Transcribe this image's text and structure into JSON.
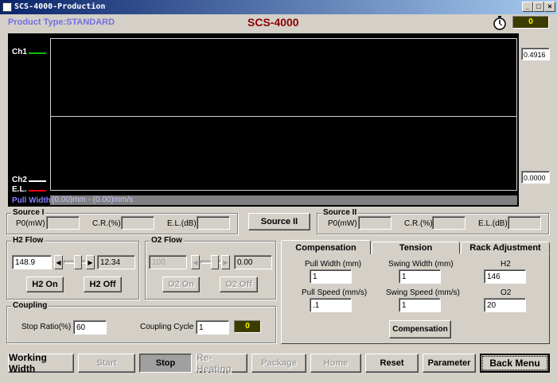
{
  "window": {
    "title": "SCS-4000-Production"
  },
  "header": {
    "product_type": "Product Type:STANDARD",
    "app_title": "SCS-4000",
    "counter": "0"
  },
  "scope": {
    "ch1_label": "Ch1",
    "ch2_label": "Ch2",
    "el_label": "E.L.",
    "pull_width_label": "Pull Width",
    "range_text": "(0.00)mm - (0.00)mm/s",
    "top_value": "0.4916",
    "bottom_value": "0.0000",
    "colors": {
      "ch1": "#00c000",
      "ch2": "#ffffff",
      "el": "#ff0000",
      "pull_width": "#8080ff"
    }
  },
  "source1": {
    "title": "Source I",
    "p0_label": "P0(mW)",
    "cr_label": "C.R.(%)",
    "el_label": "E.L.(dB)",
    "p0": "",
    "cr": "",
    "el": ""
  },
  "source_button": "Source II",
  "source2": {
    "title": "Source II",
    "p0_label": "P0(mW)",
    "cr_label": "C.R.(%)",
    "el_label": "E.L.(dB)",
    "p0": "",
    "cr": "",
    "el": ""
  },
  "h2_flow": {
    "title": "H2 Flow",
    "setpoint": "148.9",
    "reading": "12.34",
    "on_label": "H2 On",
    "off_label": "H2 Off"
  },
  "o2_flow": {
    "title": "O2 Flow",
    "setpoint": "100",
    "reading": "0.00",
    "on_label": "O2 On",
    "off_label": "O2 Off"
  },
  "coupling": {
    "title": "Coupling",
    "stop_ratio_label": "Stop Ratio(%)",
    "stop_ratio": "60",
    "cycle_label": "Coupling Cycle",
    "cycle": "1",
    "cycle_count": "0"
  },
  "tabs": [
    {
      "label": "Compensation",
      "active": true
    },
    {
      "label": "Tension",
      "active": false
    },
    {
      "label": "Rack Adjustment",
      "active": false
    }
  ],
  "compensation": {
    "pull_width_label": "Pull Width (mm)",
    "pull_width": "1",
    "swing_width_label": "Swing Width (mm)",
    "swing_width": "1",
    "h2_label": "H2",
    "h2": "146",
    "pull_speed_label": "Pull Speed (mm/s)",
    "pull_speed": ".1",
    "swing_speed_label": "Swing Speed (mm/s)",
    "swing_speed": "1",
    "o2_label": "O2",
    "o2": "20",
    "button": "Compensation"
  },
  "bottom_buttons": {
    "working_width": "Working Width",
    "start": "Start",
    "stop": "Stop",
    "reheating": "Re-Heating",
    "package": "Package",
    "home": "Home",
    "reset": "Reset",
    "parameter": "Parameter",
    "back_menu": "Back Menu"
  }
}
